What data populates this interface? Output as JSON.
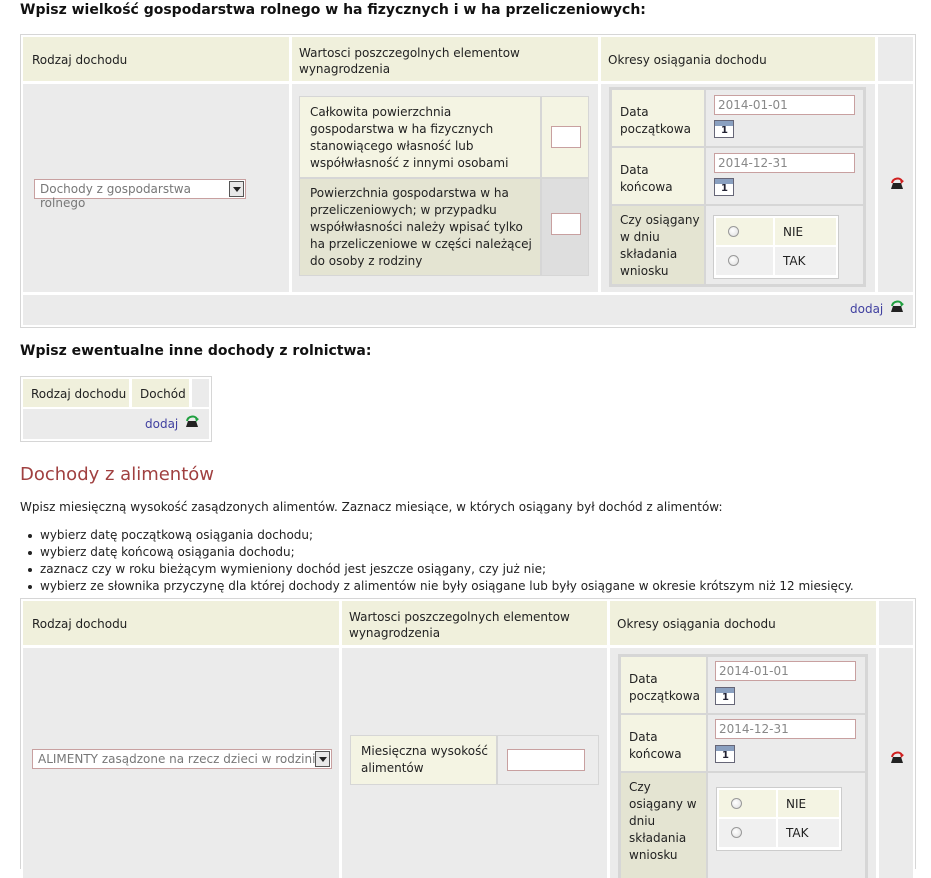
{
  "section1": {
    "heading": "Wpisz wielkość gospodarstwa rolnego w ha fizycznych i w ha przeliczeniowych:",
    "col_rodzaj": "Rodzaj dochodu",
    "col_wartosci": "Wartosci poszczegolnych elementow wynagrodzenia",
    "col_okresy": "Okresy osiągania dochodu",
    "select_value": "Dochody z gospodarstwa rolnego",
    "field1_label": "Całkowita powierzchnia gospodarstwa w ha fizycznych stanowiącego własność lub współwłasność z innymi osobami",
    "field2_label": "Powierzchnia gospodarstwa w ha przeliczeniowych; w przypadku współwłasności należy wpisać tylko ha przeliczeniowe w części należącej do osoby z rodziny",
    "date_start_label": "Data początkowa",
    "date_start": "2014-01-01",
    "date_end_label": "Data końcowa",
    "date_end": "2014-12-31",
    "czy_label": "Czy osiągany w dniu składania wniosku",
    "opt_nie": "NIE",
    "opt_tak": "TAK",
    "add": "dodaj"
  },
  "section2": {
    "heading": "Wpisz ewentualne inne dochody z rolnictwa:",
    "col_rodzaj": "Rodzaj dochodu",
    "col_dochod": "Dochód",
    "add": "dodaj"
  },
  "section3": {
    "title": "Dochody z alimentów",
    "intro": "Wpisz miesięczną wysokość zasądzonych alimentów. Zaznacz miesiące, w których osiągany był dochód z alimentów:",
    "bullets": [
      "wybierz datę początkową osiągania dochodu;",
      "wybierz datę końcową osiągania dochodu;",
      "zaznacz czy w roku bieżącym wymieniony dochód jest jeszcze osiągany, czy już nie;",
      "wybierz ze słownika przyczynę dla której dochody z alimentów nie były osiągane lub były osiągane w okresie krótszym niż 12 miesięcy."
    ],
    "col_rodzaj": "Rodzaj dochodu",
    "col_wartosci": "Wartosci poszczegolnych elementow wynagrodzenia",
    "col_okresy": "Okresy osiągania dochodu",
    "select_value": "ALIMENTY zasądzone na rzecz dzieci w rodzinie",
    "field_label": "Miesięczna wysokość alimentów",
    "date_start_label": "Data początkowa",
    "date_start": "2014-01-01",
    "date_end_label": "Data końcowa",
    "date_end": "2014-12-31",
    "czy_label": "Czy osiągany w dniu składania wniosku",
    "opt_nie": "NIE",
    "opt_tak": "TAK"
  },
  "icons": {
    "delete": "remove-row-icon",
    "add": "add-row-icon",
    "calendar": "calendar-icon",
    "calendar_day": "1"
  },
  "colors": {
    "header_bg": "#f0f0dc",
    "title_red": "#a04040",
    "link": "#4040a0"
  }
}
